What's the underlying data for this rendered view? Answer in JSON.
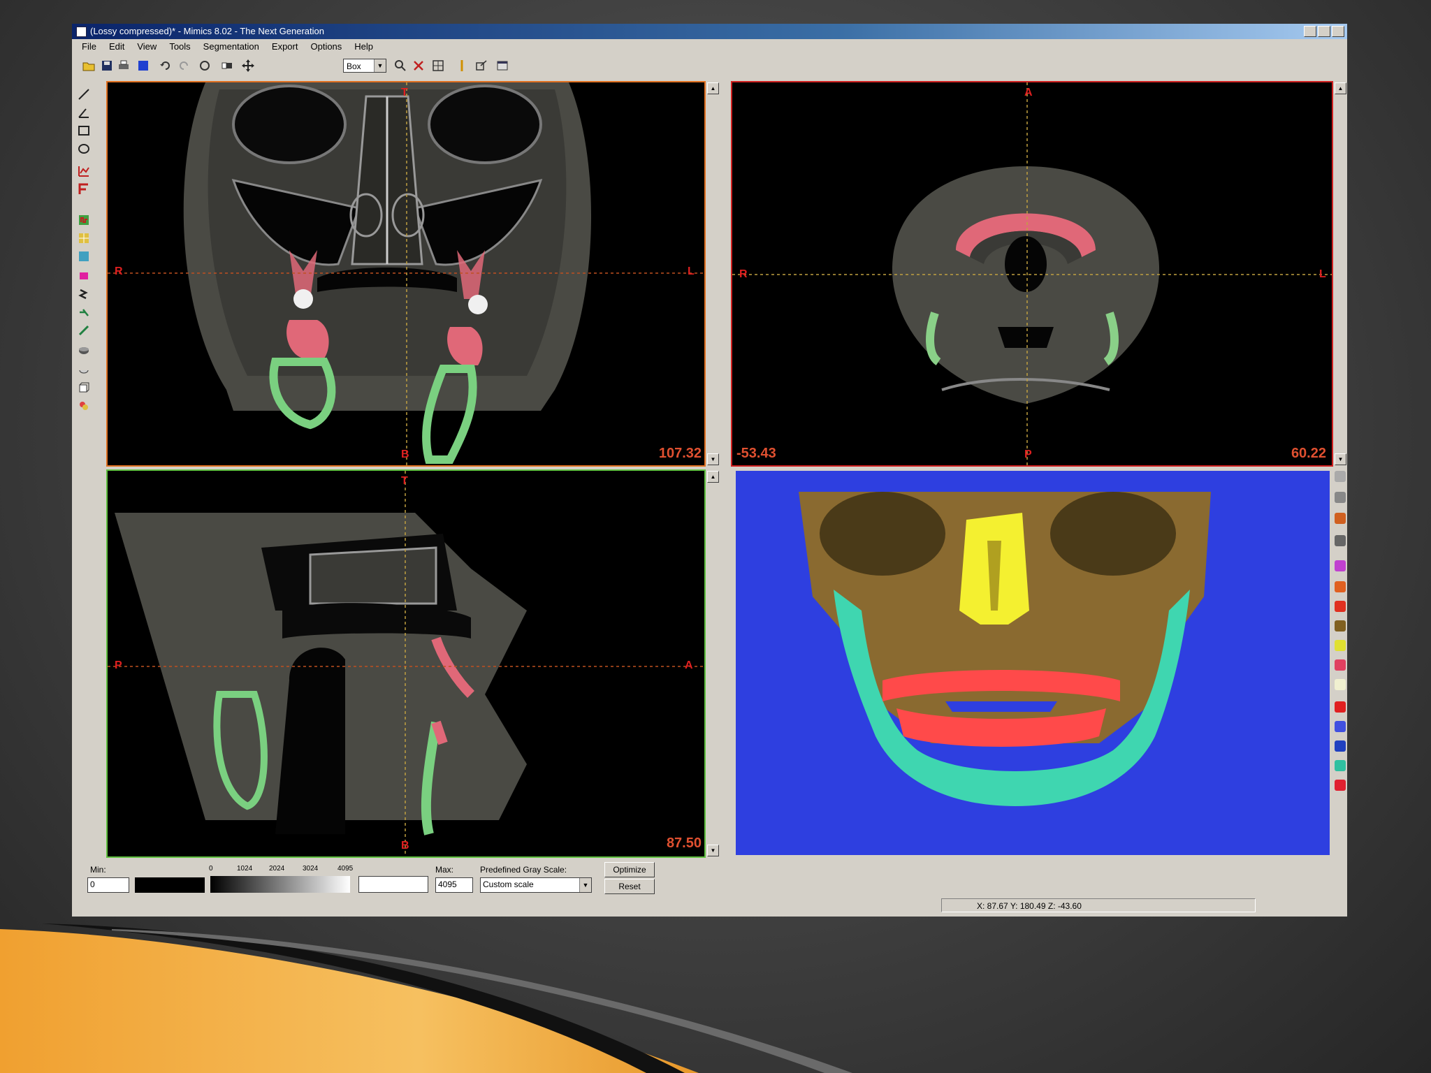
{
  "window": {
    "title": "(Lossy compressed)* - Mimics 8.02 - The Next Generation"
  },
  "menu": [
    "File",
    "Edit",
    "View",
    "Tools",
    "Segmentation",
    "Export",
    "Options",
    "Help"
  ],
  "toolbar": {
    "mode_select": "Box"
  },
  "views": {
    "coronal": {
      "top": "T",
      "left": "R",
      "right": "L",
      "bottom": "B",
      "value": "107.32"
    },
    "axial": {
      "top": "A",
      "left": "R",
      "right": "L",
      "bottom": "P",
      "value_left": "-53.43",
      "value_right": "60.22"
    },
    "sagittal": {
      "top": "T",
      "left": "P",
      "right": "A",
      "bottom": "B",
      "value": "87.50"
    }
  },
  "grayscale": {
    "min_label": "Min:",
    "min_value": "0",
    "max_label": "Max:",
    "max_value": "4095",
    "ticks": [
      "0",
      "1024",
      "2024",
      "3024",
      "4095"
    ],
    "predefined_label": "Predefined Gray Scale:",
    "predefined_value": "Custom scale",
    "optimize_label": "Optimize",
    "reset_label": "Reset"
  },
  "status": {
    "coords": "X: 87.67  Y: 180.49  Z: -43.60"
  },
  "colors": {
    "mask_teeth": "#ff5a5a",
    "mask_mandible": "#3fd6b0",
    "mask_sinus": "#f4f030",
    "bone": "#8a6a30",
    "render_bg": "#2e3fe0",
    "crosshair": "#e07020"
  },
  "icons": {
    "left_tools": [
      "line-icon",
      "angle-icon",
      "rectangle-icon",
      "ellipse-icon",
      "profile-icon",
      "threshold-icon",
      "region-grow-icon",
      "edit-mask-icon",
      "multi-slice-edit-icon",
      "morphology-icon",
      "boolean-icon",
      "fill-icon",
      "calculate-3d-icon",
      "smooth-icon",
      "wrap-icon",
      "cavity-fill-icon"
    ],
    "right_tools": [
      "rotate-icon",
      "pan-icon",
      "zoom-icon",
      "reset-view-icon"
    ]
  }
}
